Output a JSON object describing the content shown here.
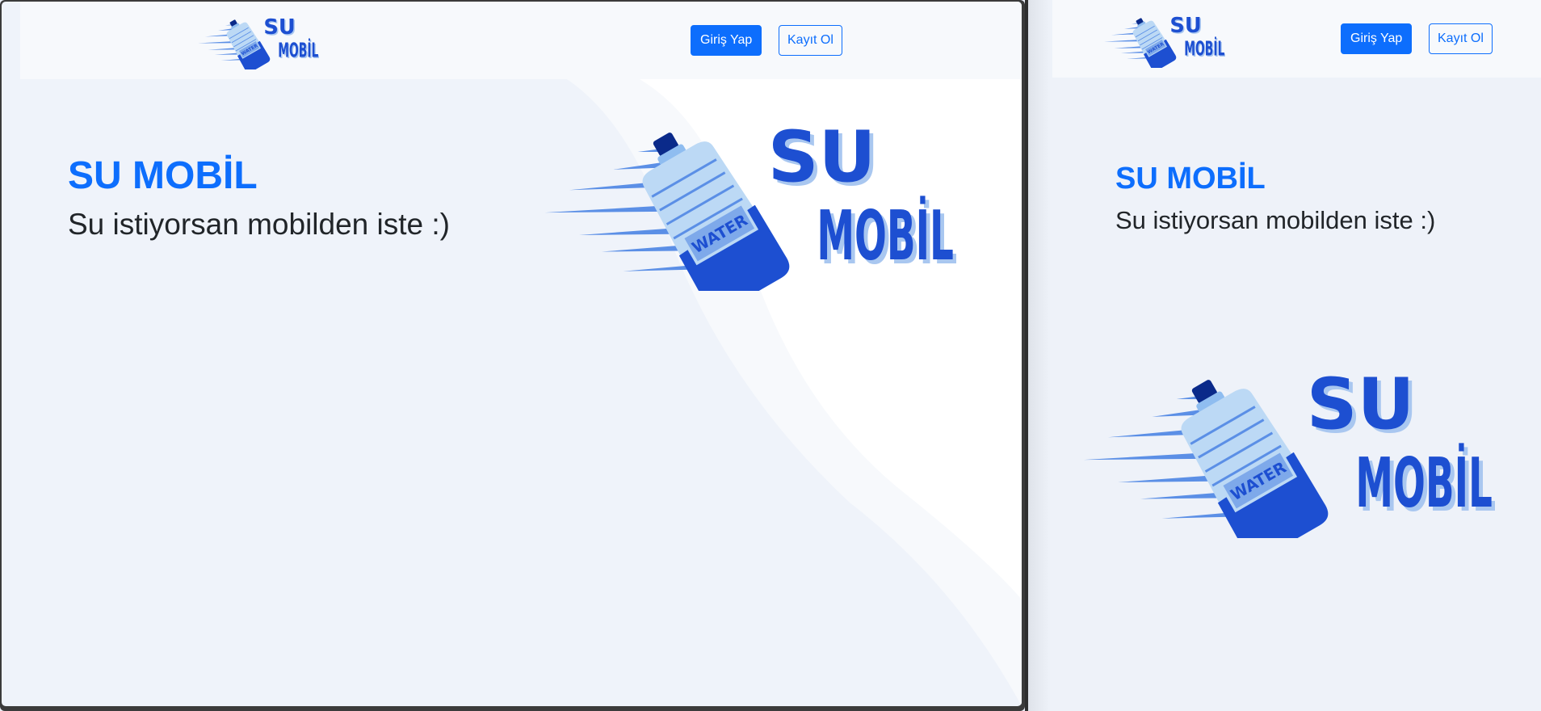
{
  "brand": {
    "logo_line1": "SU",
    "logo_line2": "MOBİL",
    "bottle_label": "WATER"
  },
  "navbar": {
    "login_label": "Giriş Yap",
    "register_label": "Kayıt Ol"
  },
  "hero": {
    "title": "SU MOBİL",
    "subtitle": "Su istiyorsan mobilden iste :)"
  },
  "colors": {
    "primary": "#0d6efd",
    "logo_dark_blue": "#1d4fd1",
    "logo_light_blue": "#bcd9f5",
    "logo_navy": "#0a2a8a",
    "page_bg": "#eff3fa"
  },
  "icons": {
    "logo": "water-bottle-logo-icon"
  }
}
